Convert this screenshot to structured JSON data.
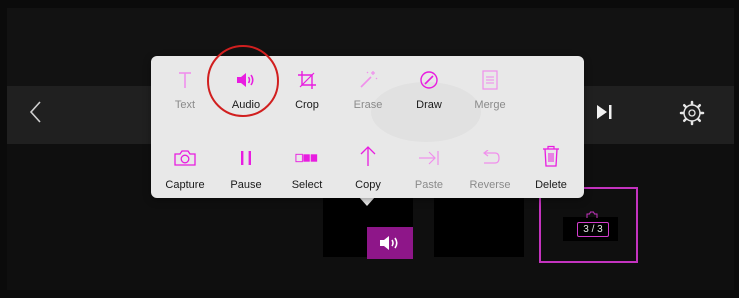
{
  "colors": {
    "accent": "#e81ce0",
    "accent_disabled": "#f08fec",
    "toolbar_bg": "#202020",
    "popup_bg": "#e8e8e8",
    "audio_badge_bg": "#8e1689",
    "highlight_ring": "#d11f1f"
  },
  "toolbar": {
    "back_icon": "chevron-left-icon",
    "next_icon": "skip-forward-icon",
    "settings_icon": "gear-icon"
  },
  "menu": {
    "row1": [
      {
        "label": "Text",
        "icon": "text-icon",
        "enabled": false
      },
      {
        "label": "Audio",
        "icon": "speaker-icon",
        "enabled": true
      },
      {
        "label": "Crop",
        "icon": "crop-icon",
        "enabled": true
      },
      {
        "label": "Erase",
        "icon": "magic-wand-icon",
        "enabled": false
      },
      {
        "label": "Draw",
        "icon": "pencil-circle-icon",
        "enabled": true
      },
      {
        "label": "Merge",
        "icon": "merge-doc-icon",
        "enabled": false
      }
    ],
    "row2": [
      {
        "label": "Capture",
        "icon": "camera-icon",
        "enabled": true
      },
      {
        "label": "Pause",
        "icon": "pause-icon",
        "enabled": true
      },
      {
        "label": "Select",
        "icon": "select-icon",
        "enabled": true
      },
      {
        "label": "Copy",
        "icon": "arrow-up-icon",
        "enabled": true
      },
      {
        "label": "Paste",
        "icon": "arrow-right-bar-icon",
        "enabled": false
      },
      {
        "label": "Reverse",
        "icon": "undo-icon",
        "enabled": false
      },
      {
        "label": "Delete",
        "icon": "trash-icon",
        "enabled": true
      }
    ]
  },
  "timeline": {
    "audio_badge_icon": "speaker-icon",
    "counter": "3 / 3"
  }
}
